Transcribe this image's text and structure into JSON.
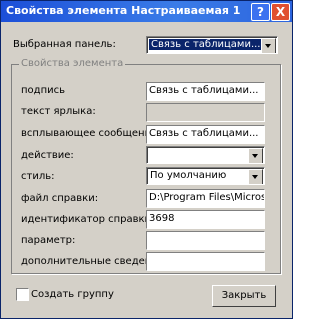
{
  "window": {
    "title": "Свойства элемента Настраиваемая 1",
    "help_label": "?",
    "close_label": "X"
  },
  "panel": {
    "label": "Выбранная панель:",
    "value": "Связь с таблицами..."
  },
  "group": {
    "legend": "Свойства элемента"
  },
  "rows": [
    {
      "label": "подпись",
      "value": "Связь с таблицами..."
    },
    {
      "label": "текст ярлыка:",
      "value": ""
    },
    {
      "label": "всплывающее сообщение",
      "value": "Связь с таблицами..."
    },
    {
      "label": "действие:",
      "value": ""
    },
    {
      "label": "стиль:",
      "value": "По умолчанию"
    },
    {
      "label": "файл справки:",
      "value": "D:\\Program Files\\Microsoft O"
    },
    {
      "label": "идентификатор справки:",
      "value": "3698"
    },
    {
      "label": "параметр:",
      "value": ""
    },
    {
      "label": "дополнительные сведения:",
      "value": ""
    }
  ],
  "create_group": {
    "label": "Создать группу",
    "checked": false
  },
  "close_button": {
    "label": "Закрыть"
  }
}
